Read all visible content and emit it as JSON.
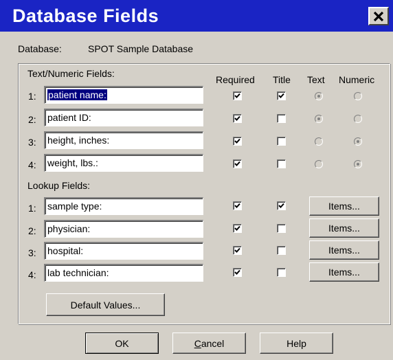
{
  "window": {
    "title": "Database Fields"
  },
  "database": {
    "label": "Database:",
    "value": "SPOT Sample Database"
  },
  "text_numeric": {
    "heading": "Text/Numeric Fields:",
    "columns": {
      "required": "Required",
      "title": "Title",
      "text": "Text",
      "numeric": "Numeric"
    },
    "rows": [
      {
        "num": "1:",
        "value": "patient name:",
        "required": true,
        "title": true,
        "type": "text"
      },
      {
        "num": "2:",
        "value": "patient ID:",
        "required": true,
        "title": false,
        "type": "text"
      },
      {
        "num": "3:",
        "value": "height, inches:",
        "required": true,
        "title": false,
        "type": "numeric"
      },
      {
        "num": "4:",
        "value": "weight, lbs.:",
        "required": true,
        "title": false,
        "type": "numeric"
      }
    ]
  },
  "lookup": {
    "heading": "Lookup Fields:",
    "items_label": "Items...",
    "rows": [
      {
        "num": "1:",
        "value": "sample type:",
        "required": true,
        "title": true
      },
      {
        "num": "2:",
        "value": "physician:",
        "required": true,
        "title": false
      },
      {
        "num": "3:",
        "value": "hospital:",
        "required": true,
        "title": false
      },
      {
        "num": "4:",
        "value": "lab technician:",
        "required": true,
        "title": false
      }
    ]
  },
  "buttons": {
    "default_values": "Default Values...",
    "ok": "OK",
    "cancel_mnemonic": "C",
    "cancel_rest": "ancel",
    "help": "Help"
  },
  "colors": {
    "titlebar": "#1a24c4",
    "face": "#d4d0c8",
    "selection": "#000080"
  },
  "icons": {
    "close": "close-icon",
    "check": "checkmark-icon"
  }
}
